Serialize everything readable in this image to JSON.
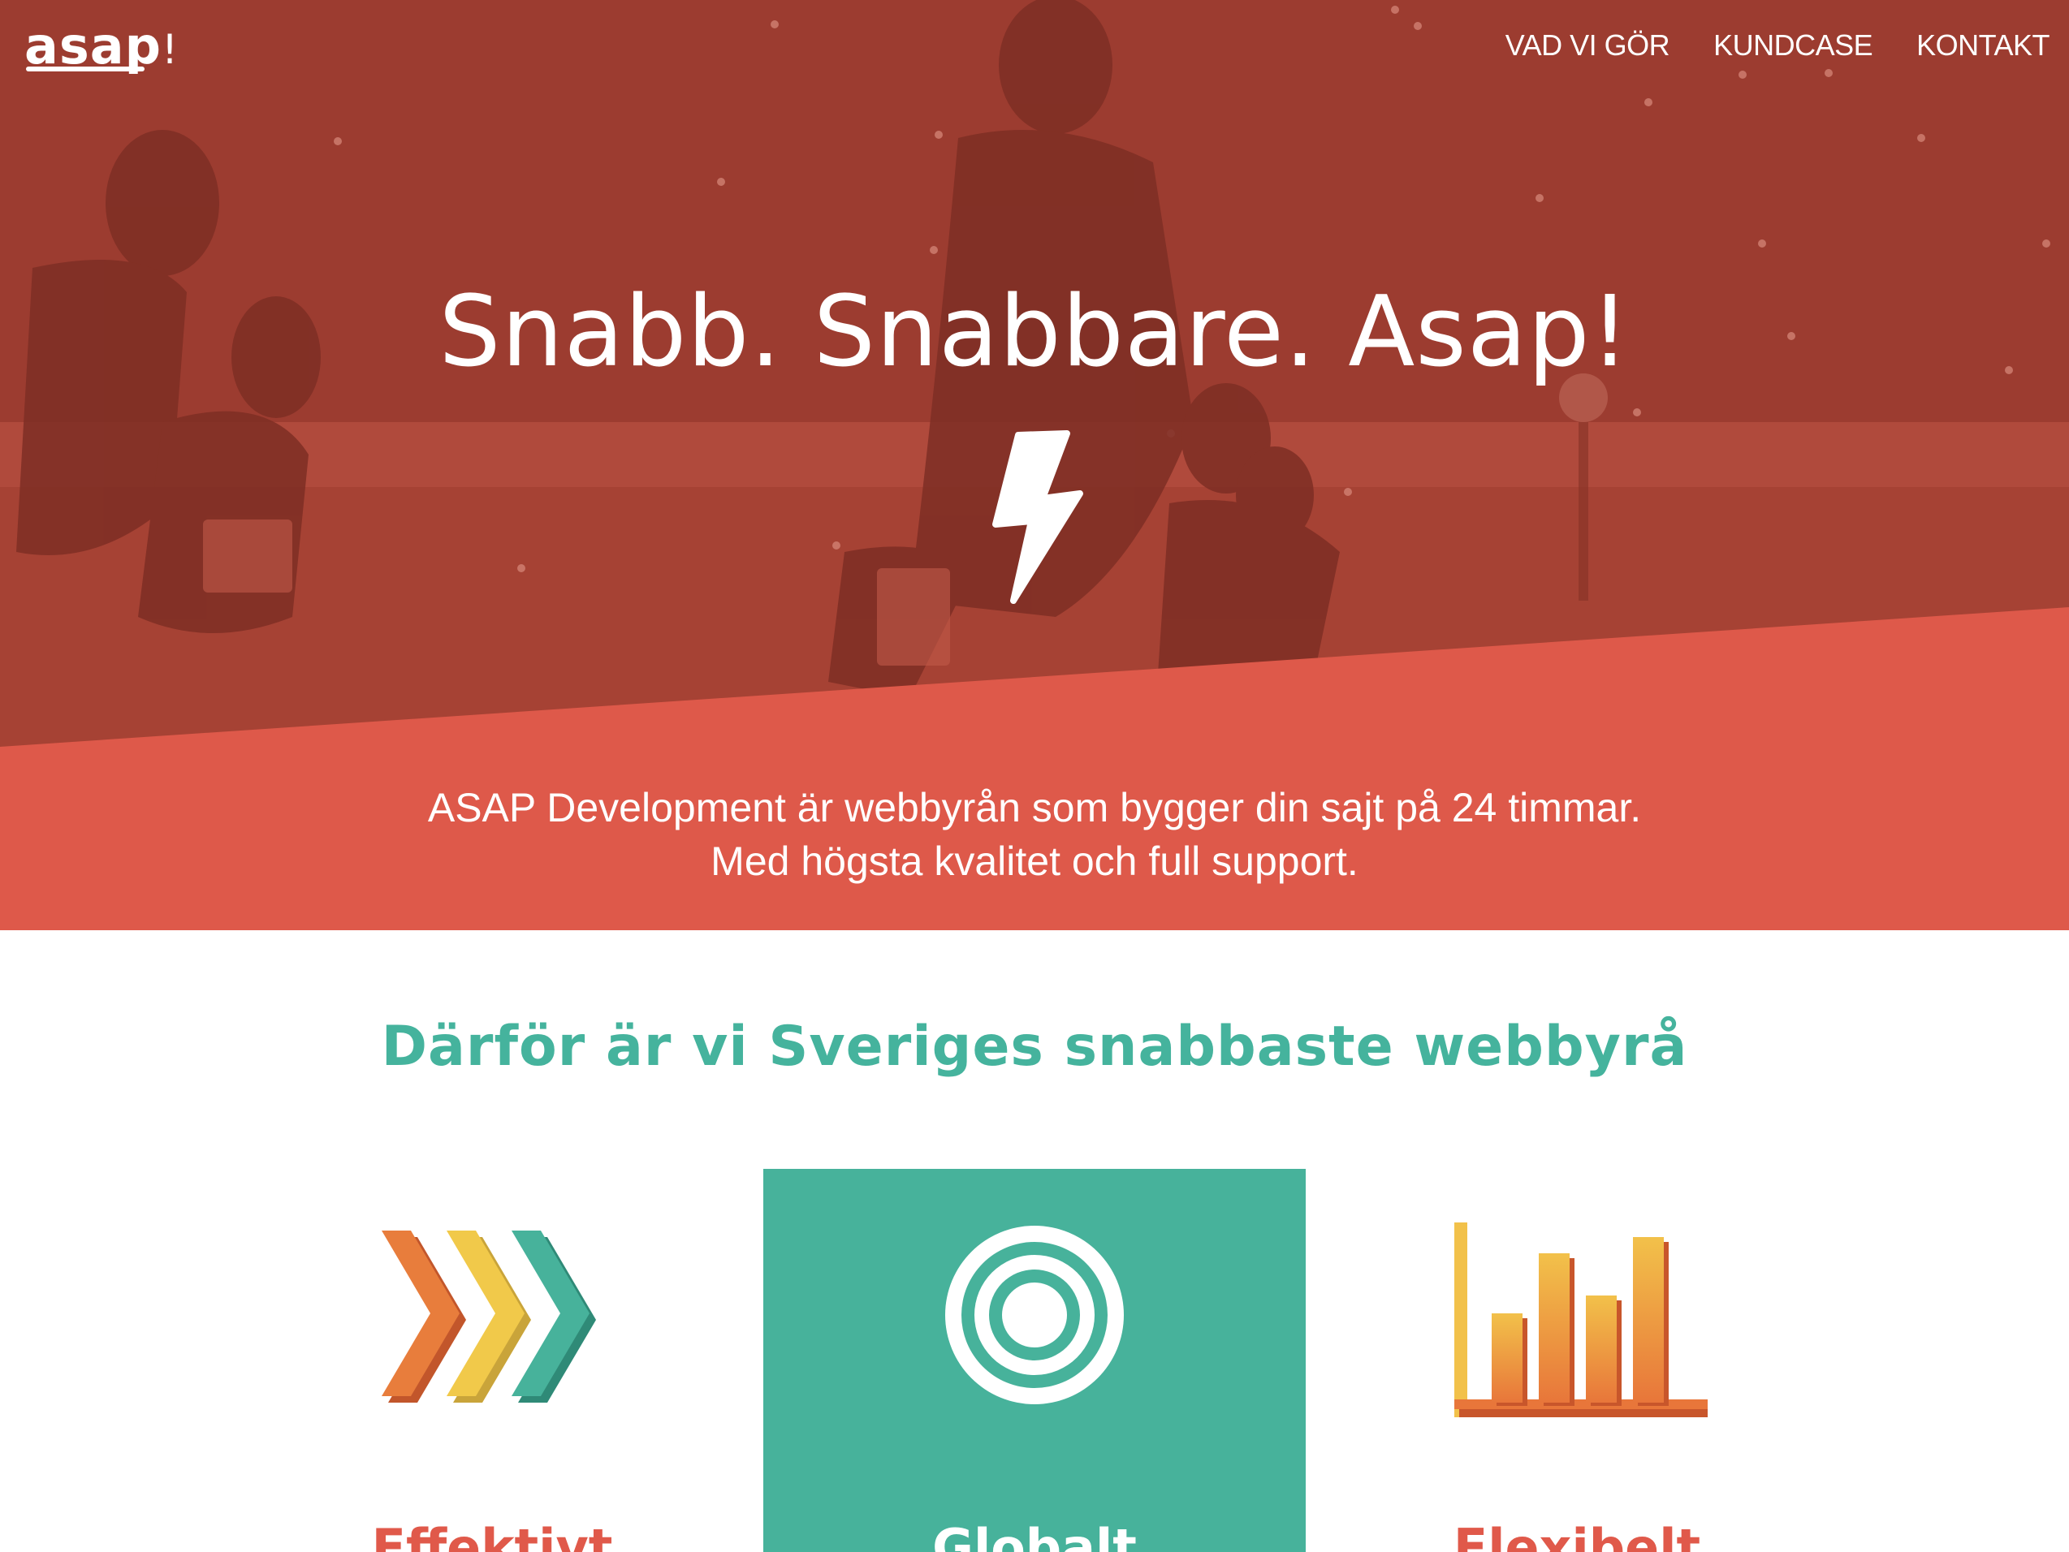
{
  "brand": {
    "logo": "asap",
    "logo_bang": "!"
  },
  "nav": {
    "items": [
      "VAD VI GÖR",
      "KUNDCASE",
      "KONTAKT"
    ]
  },
  "hero": {
    "headline": "Snabb. Snabbare. Asap!",
    "tagline_line1": "ASAP Development är webbyrån som bygger din sajt på 24 timmar.",
    "tagline_line2": "Med högsta kvalitet och full support."
  },
  "section": {
    "title": "Därför är vi Sveriges snabbaste webbyrå",
    "features": [
      {
        "label": "Effektivt",
        "icon": "chevrons-icon"
      },
      {
        "label": "Globalt",
        "icon": "target-icon"
      },
      {
        "label": "Flexibelt",
        "icon": "bar-chart-icon"
      }
    ]
  },
  "colors": {
    "accent": "#de594a",
    "teal": "#47b29b",
    "hero_overlay": "#a84234"
  }
}
